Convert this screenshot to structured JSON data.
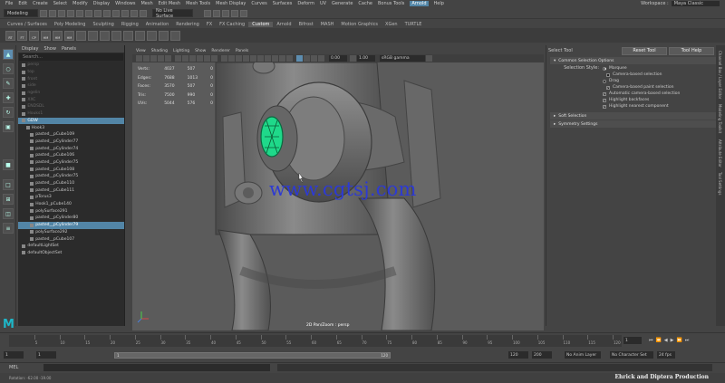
{
  "menubar": {
    "items": [
      "File",
      "Edit",
      "Create",
      "Select",
      "Modify",
      "Display",
      "Windows",
      "Mesh",
      "Edit Mesh",
      "Mesh Tools",
      "Mesh Display",
      "Curves",
      "Surfaces",
      "Deform",
      "UV",
      "Generate",
      "Cache",
      "Bonus Tools",
      "Arnold",
      "Help"
    ],
    "highlighted": "Arnold",
    "workspace_label": "Workspace :",
    "workspace_value": "Maya Classic"
  },
  "status": {
    "mode": "Modeling",
    "live_surface": "No Live Surface"
  },
  "shelf_tabs": [
    "Curves / Surfaces",
    "Poly Modeling",
    "Sculpting",
    "Rigging",
    "Animation",
    "Rendering",
    "FX",
    "FX Caching",
    "Custom",
    "Arnold",
    "Bifrost",
    "MASH",
    "Motion Graphics",
    "XGen",
    "TURTLE"
  ],
  "shelf_active_tab": "Custom",
  "shelf_buttons": [
    "RT",
    "FT",
    "CP",
    "HM",
    "HM",
    "HM",
    "",
    "",
    "",
    "",
    "",
    "",
    "",
    "",
    ""
  ],
  "outliner": {
    "menu": [
      "Display",
      "Show",
      "Panels"
    ],
    "search_placeholder": "Search...",
    "rows": [
      {
        "label": "persp",
        "indent": 2,
        "dim": true,
        "selected": false
      },
      {
        "label": "top",
        "indent": 2,
        "dim": true,
        "selected": false
      },
      {
        "label": "front",
        "indent": 2,
        "dim": true,
        "selected": false
      },
      {
        "label": "side",
        "indent": 2,
        "dim": true,
        "selected": false
      },
      {
        "label": "ngelin",
        "indent": 2,
        "dim": true,
        "selected": false
      },
      {
        "label": "XXC",
        "indent": 2,
        "dim": true,
        "selected": false
      },
      {
        "label": "ENDSDL",
        "indent": 2,
        "dim": true,
        "selected": false
      },
      {
        "label": "Houks1",
        "indent": 2,
        "dim": true,
        "selected": false
      },
      {
        "label": "GDW",
        "indent": 2,
        "dim": false,
        "selected": true
      },
      {
        "label": "Hook3",
        "indent": 4,
        "dim": false,
        "selected": false
      },
      {
        "label": "pasted__pCube109",
        "indent": 6,
        "dim": false,
        "selected": false
      },
      {
        "label": "pasted__pCylinder77",
        "indent": 6,
        "dim": false,
        "selected": false
      },
      {
        "label": "pasted__pCylinder74",
        "indent": 6,
        "dim": false,
        "selected": false
      },
      {
        "label": "pasted__pCube106",
        "indent": 6,
        "dim": false,
        "selected": false
      },
      {
        "label": "pasted__pCylinder75",
        "indent": 6,
        "dim": false,
        "selected": false
      },
      {
        "label": "pasted__pCube108",
        "indent": 6,
        "dim": false,
        "selected": false
      },
      {
        "label": "pasted__pCylinder75",
        "indent": 6,
        "dim": false,
        "selected": false
      },
      {
        "label": "pasted__pCube110",
        "indent": 6,
        "dim": false,
        "selected": false
      },
      {
        "label": "pasted__pCube111",
        "indent": 6,
        "dim": false,
        "selected": false
      },
      {
        "label": "pTorus3",
        "indent": 6,
        "dim": false,
        "selected": false
      },
      {
        "label": "Hook1_pCube140",
        "indent": 6,
        "dim": false,
        "selected": false
      },
      {
        "label": "polySurface291",
        "indent": 6,
        "dim": false,
        "selected": false
      },
      {
        "label": "pasted__pCylinder80",
        "indent": 6,
        "dim": false,
        "selected": false
      },
      {
        "label": "pasted__pCylinder79",
        "indent": 6,
        "dim": false,
        "selected": true
      },
      {
        "label": "polySurface292",
        "indent": 6,
        "dim": false,
        "selected": false
      },
      {
        "label": "pasted__pCube107",
        "indent": 6,
        "dim": false,
        "selected": false
      },
      {
        "label": "defaultLightSet",
        "indent": 2,
        "dim": false,
        "selected": false
      },
      {
        "label": "defaultObjectSet",
        "indent": 2,
        "dim": false,
        "selected": false
      }
    ]
  },
  "viewport": {
    "panel_menu": [
      "View",
      "Shading",
      "Lighting",
      "Show",
      "Renderer",
      "Panels"
    ],
    "gamma_label": "sRGB gamma",
    "field_a": "0.00",
    "field_b": "1.00",
    "hud": [
      {
        "label": "Verts:",
        "a": "4027",
        "b": "507",
        "c": "0"
      },
      {
        "label": "Edges:",
        "a": "7688",
        "b": "1013",
        "c": "0"
      },
      {
        "label": "Faces:",
        "a": "3570",
        "b": "507",
        "c": "0"
      },
      {
        "label": "Tris:",
        "a": "7500",
        "b": "990",
        "c": "0"
      },
      {
        "label": "UVs:",
        "a": "5044",
        "b": "576",
        "c": "0"
      }
    ],
    "camera_label": "2D Pan/Zoom : persp",
    "watermark": "www.cgtsj.com"
  },
  "tool_settings": {
    "title": "Select Tool",
    "reset_button": "Reset Tool",
    "help_button": "Tool Help",
    "sections": {
      "common": "Common Selection Options",
      "soft": "Soft Selection",
      "symmetry": "Symmetry Settings"
    },
    "selection_style_label": "Selection Style:",
    "options": [
      {
        "kind": "radio",
        "label": "Marquee",
        "on": true,
        "indent": 0
      },
      {
        "kind": "check",
        "label": "Camera-based selection",
        "on": false,
        "indent": 4
      },
      {
        "kind": "radio",
        "label": "Drag",
        "on": false,
        "indent": 0
      },
      {
        "kind": "check",
        "label": "Camera-based paint selection",
        "on": true,
        "indent": 4
      },
      {
        "kind": "check",
        "label": "Automatic camera-based selection",
        "on": true,
        "indent": 0
      },
      {
        "kind": "check",
        "label": "Highlight backfaces",
        "on": true,
        "indent": 0
      },
      {
        "kind": "check",
        "label": "Highlight nearest component",
        "on": true,
        "indent": 0
      }
    ],
    "side_tabs": [
      "Channel Box / Layer Editor",
      "Modeling Toolkit",
      "Attribute Editor",
      "Tool Settings"
    ]
  },
  "timeline": {
    "ticks": [
      "5",
      "10",
      "15",
      "20",
      "25",
      "30",
      "35",
      "40",
      "45",
      "50",
      "55",
      "60",
      "65",
      "70",
      "75",
      "80",
      "85",
      "90",
      "95",
      "100",
      "105",
      "110",
      "115",
      "120"
    ],
    "current_frame": "1",
    "start": "1",
    "start_inner": "1",
    "range_start_label": "1",
    "range_end_label": "120",
    "end_inner": "120",
    "end": "200",
    "anim_layer": "No Anim Layer",
    "char_set": "No Character Set",
    "fps": "24 fps"
  },
  "cmdline": {
    "label": "MEL"
  },
  "helpline": {
    "text": "Rotation:  -62.00   -19.00"
  },
  "credit": "Ehrick  and  Diptera  Production",
  "logo": "M"
}
